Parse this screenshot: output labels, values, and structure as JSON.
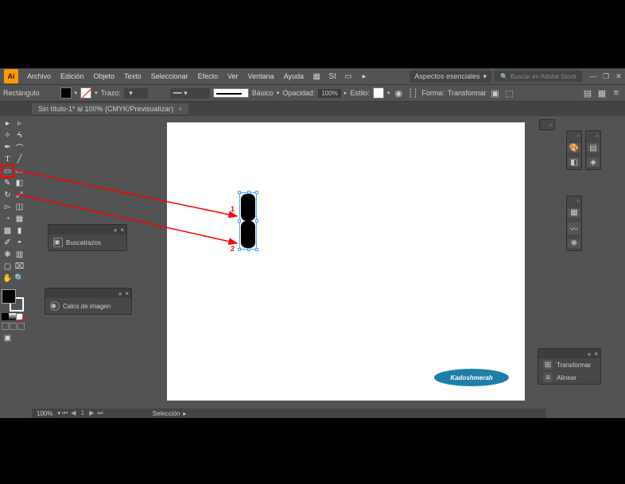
{
  "menu": {
    "items": [
      "Archivo",
      "Edición",
      "Objeto",
      "Texto",
      "Seleccionar",
      "Efecto",
      "Ver",
      "Ventana",
      "Ayuda"
    ],
    "workspace": "Aspectos esenciales",
    "search_placeholder": "Buscar en Adobe Stock"
  },
  "control": {
    "shape_label": "Rectángulo",
    "stroke_label": "Trazo:",
    "stroke_profile": "Básico",
    "opacity_label": "Opacidad:",
    "opacity_value": "100%",
    "style_label": "Estilo:",
    "shape_btn": "Forma:",
    "transform_btn": "Transformar"
  },
  "doc": {
    "tab": "Sin título-1* al 100% (CMYK/Previsualizar)"
  },
  "panels": {
    "pathfinder": "Buscatrazos",
    "image_trace": "Calco de imagen",
    "transform": "Transformar",
    "align": "Alinear"
  },
  "status": {
    "zoom": "100%",
    "page": "1",
    "mode": "Selección"
  },
  "annotations": {
    "n1": "1",
    "n2": "2"
  },
  "watermark": "Kadoshmerah"
}
